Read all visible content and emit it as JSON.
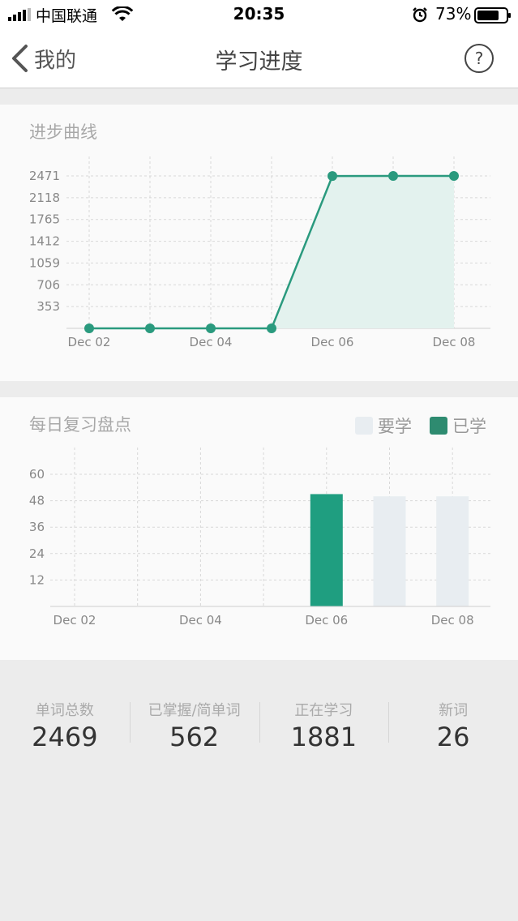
{
  "status_bar": {
    "carrier": "中国联通",
    "time": "20:35",
    "battery": "73%",
    "icons": [
      "signal-icon",
      "wifi-icon",
      "alarm-icon",
      "battery-icon"
    ]
  },
  "nav": {
    "back_label": "我的",
    "title": "学习进度",
    "help_icon": "question-circle-icon"
  },
  "progress_card": {
    "title": "进步曲线"
  },
  "daily_card": {
    "title": "每日复习盘点",
    "legend": [
      {
        "label": "要学",
        "color": "#e8edf1"
      },
      {
        "label": "已学",
        "color": "#2e8b70"
      }
    ]
  },
  "stats": [
    {
      "label": "单词总数",
      "value": "2469"
    },
    {
      "label": "已掌握/简单词",
      "value": "562"
    },
    {
      "label": "正在学习",
      "value": "1881"
    },
    {
      "label": "新词",
      "value": "26"
    }
  ],
  "colors": {
    "accent": "#2a9a7e",
    "bar_learned": "#1f9e80",
    "bar_to_learn": "#e8edf1"
  },
  "chart_data": [
    {
      "type": "area",
      "title": "进步曲线",
      "x": [
        "Dec 02",
        "Dec 03",
        "Dec 04",
        "Dec 05",
        "Dec 06",
        "Dec 07",
        "Dec 08"
      ],
      "x_tick_labels": [
        "Dec 02",
        "Dec 04",
        "Dec 06",
        "Dec 08"
      ],
      "y_tick_labels": [
        "353",
        "706",
        "1059",
        "1412",
        "1765",
        "2118",
        "2471"
      ],
      "series": [
        {
          "values": [
            0,
            0,
            0,
            0,
            2469,
            2471,
            2471
          ]
        }
      ],
      "ylim": [
        0,
        2471
      ],
      "grid": true
    },
    {
      "type": "bar",
      "title": "每日复习盘点",
      "x": [
        "Dec 02",
        "Dec 03",
        "Dec 04",
        "Dec 05",
        "Dec 06",
        "Dec 07",
        "Dec 08"
      ],
      "x_tick_labels": [
        "Dec 02",
        "Dec 04",
        "Dec 06",
        "Dec 08"
      ],
      "y_tick_labels": [
        "12",
        "24",
        "36",
        "48",
        "60"
      ],
      "series": [
        {
          "name": "要学",
          "values": [
            0,
            0,
            0,
            0,
            0,
            50,
            50
          ]
        },
        {
          "name": "已学",
          "values": [
            0,
            0,
            0,
            0,
            51,
            0,
            0
          ]
        }
      ],
      "ylim": [
        0,
        60
      ],
      "grid": true,
      "legend": "top-right"
    }
  ]
}
